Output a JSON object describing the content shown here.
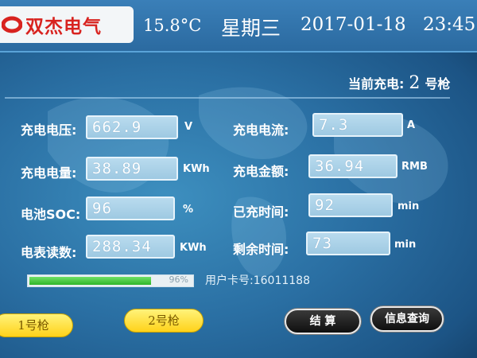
{
  "header": {
    "brand": "双杰电气",
    "temperature": "15.8°C",
    "weekday": "星期三",
    "date": "2017-01-18",
    "time": "23:45"
  },
  "current_gun": {
    "label_prefix": "当前充电:",
    "number": "2",
    "label_suffix": "号枪"
  },
  "readings": [
    {
      "label": "充电电压:",
      "value": "662.9",
      "unit": "V"
    },
    {
      "label": "充电电流:",
      "value": "7.3",
      "unit": "A"
    },
    {
      "label": "充电电量:",
      "value": "38.89",
      "unit": "KWh"
    },
    {
      "label": "充电金额:",
      "value": "36.94",
      "unit": "RMB"
    },
    {
      "label": "电池SOC:",
      "value": "96",
      "unit": "%"
    },
    {
      "label": "已充时间:",
      "value": "92",
      "unit": "min"
    },
    {
      "label": "电表读数:",
      "value": "288.34",
      "unit": "KWh"
    },
    {
      "label": "剩余时间:",
      "value": "73",
      "unit": "min"
    }
  ],
  "progress": {
    "fraction": 0.96,
    "text": "96%"
  },
  "card": {
    "text": "用户卡号:16011188"
  },
  "buttons": {
    "gun1": "1号枪",
    "gun2": "2号枪",
    "settle": "结 算",
    "info": "信息查询"
  },
  "colors": {
    "brand_red": "#d8231f",
    "screen_blue": "#2a6fa3",
    "progress_green": "#2fb52a",
    "button_yellow": "#ffd21a"
  }
}
